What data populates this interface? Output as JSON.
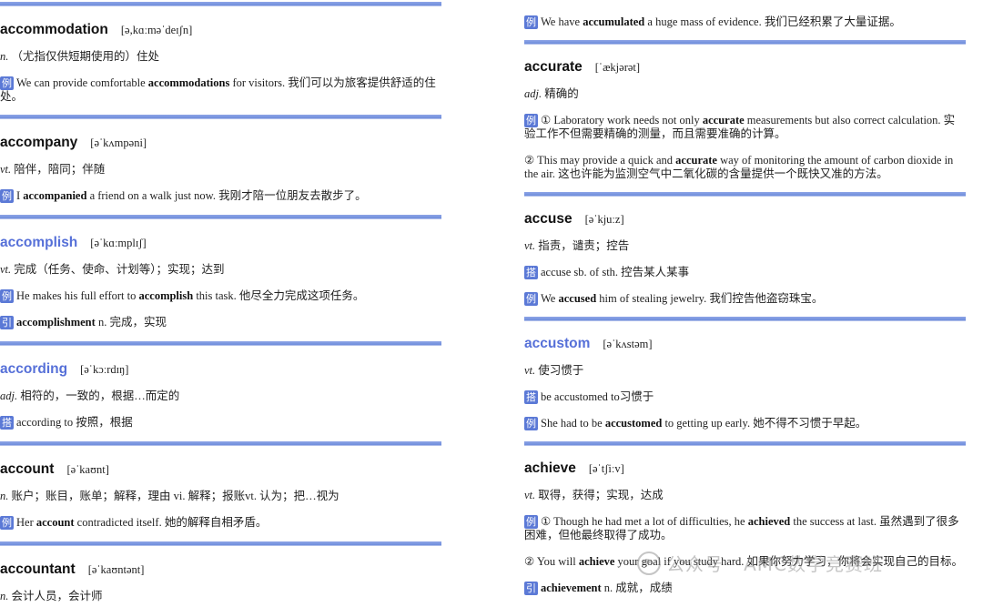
{
  "left": [
    {
      "headword": "accommodation",
      "blue": false,
      "ipa": "[ə,kɑːməˈdeɪʃn]",
      "sense_pos": "n.",
      "sense": "（尤指仅供短期使用的）住处",
      "rows": [
        {
          "tag": "例",
          "pre": "We can provide comfortable ",
          "bold": "accommodations",
          "post": " for visitors. 我们可以为旅客提供舒适的住",
          "cont": "处。"
        }
      ]
    },
    {
      "headword": "accompany",
      "blue": false,
      "ipa": "[əˈkʌmpəni]",
      "sense_pos": "vt.",
      "sense": "陪伴，陪同；伴随",
      "rows": [
        {
          "tag": "例",
          "pre": "I ",
          "bold": "accompanied",
          "post": " a friend on a walk just now. 我刚才陪一位朋友去散步了。",
          "cont": ""
        }
      ]
    },
    {
      "headword": "accomplish",
      "blue": true,
      "ipa": "[əˈkɑːmplɪʃ]",
      "sense_pos": "vt.",
      "sense": "完成（任务、使命、计划等）；实现；达到",
      "rows": [
        {
          "tag": "例",
          "pre": "He makes his full effort to ",
          "bold": "accomplish",
          "post": " this task. 他尽全力完成这项任务。",
          "cont": ""
        },
        {
          "tag": "引",
          "pre": "",
          "bold": "accomplishment",
          "post": " n. 完成，实现",
          "cont": ""
        }
      ]
    },
    {
      "headword": "according",
      "blue": true,
      "ipa": "[əˈkɔːrdɪŋ]",
      "sense_pos": "adj.",
      "sense": "相符的，一致的，根据…而定的",
      "rows": [
        {
          "tag": "搭",
          "pre": "according to 按照，根据",
          "bold": "",
          "post": "",
          "cont": ""
        }
      ]
    },
    {
      "headword": "account",
      "blue": false,
      "ipa": "[əˈkaʊnt]",
      "sense_pos": "n.",
      "sense": "账户；账目，账单；解释，理由 vi. 解释；报账vt. 认为；把…视为",
      "rows": [
        {
          "tag": "例",
          "pre": "Her ",
          "bold": "account",
          "post": " contradicted itself. 她的解释自相矛盾。",
          "cont": ""
        }
      ]
    },
    {
      "headword": "accountant",
      "blue": false,
      "ipa": "[əˈkaʊntənt]",
      "sense_pos": "n.",
      "sense": "会计人员，会计师",
      "rows": []
    }
  ],
  "right_top_example": {
    "tag": "例",
    "pre": "We have ",
    "bold": "accumulated",
    "post": " a huge mass of evidence. 我们已经积累了大量证据。"
  },
  "right": [
    {
      "headword": "accurate",
      "blue": false,
      "ipa": "[ˈækjərət]",
      "sense_pos": "adj.",
      "sense": "精确的",
      "rows": [
        {
          "tag": "例",
          "pre": "① Laboratory work needs not only ",
          "bold": "accurate",
          "post": " measurements but also correct calculation. 实",
          "cont": "验工作不但需要精确的测量，而且需要准确的计算。"
        },
        {
          "tag": "",
          "pre": "② This may provide a quick and ",
          "bold": "accurate",
          "post": " way of monitoring the amount of carbon dioxide in",
          "cont": "the air. 这也许能为监测空气中二氧化碳的含量提供一个既快又准的方法。"
        }
      ]
    },
    {
      "headword": "accuse",
      "blue": false,
      "ipa": "[əˈkjuːz]",
      "sense_pos": "vt.",
      "sense": "指责，谴责；控告",
      "rows": [
        {
          "tag": "搭",
          "pre": "accuse sb. of sth. 控告某人某事",
          "bold": "",
          "post": "",
          "cont": ""
        },
        {
          "tag": "例",
          "pre": "We ",
          "bold": "accused",
          "post": " him of stealing jewelry. 我们控告他盗窃珠宝。",
          "cont": ""
        }
      ]
    },
    {
      "headword": "accustom",
      "blue": true,
      "ipa": "[əˈkʌstəm]",
      "sense_pos": "vt.",
      "sense": "使习惯于",
      "rows": [
        {
          "tag": "搭",
          "pre": "be accustomed to习惯于",
          "bold": "",
          "post": "",
          "cont": ""
        },
        {
          "tag": "例",
          "pre": "She had to be ",
          "bold": "accustomed",
          "post": " to getting up early. 她不得不习惯于早起。",
          "cont": ""
        }
      ]
    },
    {
      "headword": "achieve",
      "blue": false,
      "ipa": "[əˈtʃiːv]",
      "sense_pos": "vt.",
      "sense": "取得，获得；实现，达成",
      "rows": [
        {
          "tag": "例",
          "pre": "① Though he had met a lot of difficulties, he ",
          "bold": "achieved",
          "post": " the success at last. 虽然遇到了很多",
          "cont": "困难，但他最终取得了成功。"
        },
        {
          "tag": "",
          "pre": "② You will ",
          "bold": "achieve",
          "post": " your goal if you study hard. 如果你努力学习，你将会实现自己的目标。",
          "cont": ""
        },
        {
          "tag": "引",
          "pre": "",
          "bold": "achievement",
          "post": " n. 成就，成绩",
          "cont": ""
        }
      ]
    }
  ],
  "watermark": "公众号 · AMC数学竞赛班"
}
